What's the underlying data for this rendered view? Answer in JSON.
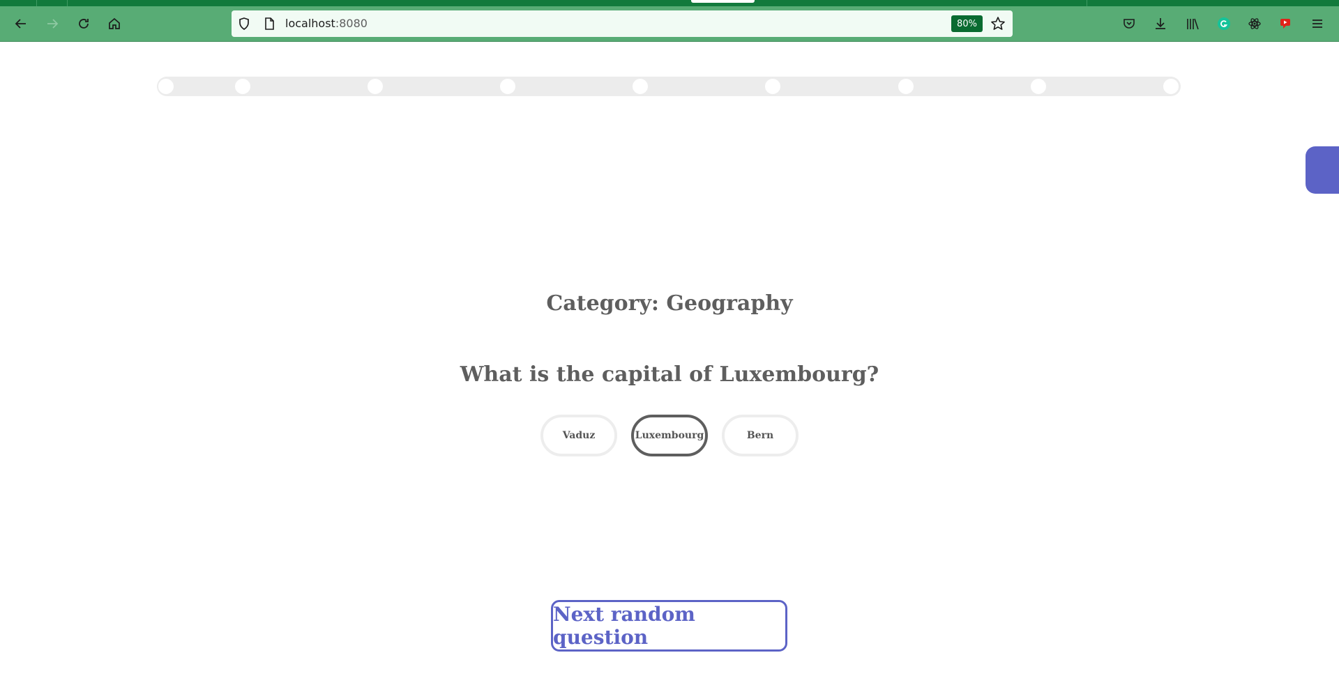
{
  "browser": {
    "url_host": "localhost",
    "url_port": ":8080",
    "zoom": "80%",
    "colors": {
      "toolbar": "#58ac75",
      "tabstrip": "#127a3c",
      "zoom_badge": "#0a6b31"
    },
    "icons": [
      "back-icon",
      "forward-icon",
      "reload-icon",
      "home-icon",
      "shield-icon",
      "page-icon",
      "star-icon",
      "pocket-icon",
      "download-icon",
      "library-icon",
      "grammarly-icon",
      "react-devtools-icon",
      "video-extension-icon",
      "menu-icon"
    ]
  },
  "quiz": {
    "progress_steps": 9,
    "category": "Category: Geography",
    "question": "What is the capital of Luxembourg?",
    "answers": [
      {
        "label": "Vaduz",
        "selected": false
      },
      {
        "label": "Luxembourg",
        "selected": true
      },
      {
        "label": "Bern",
        "selected": false
      }
    ],
    "next_button": "Next random question",
    "colors": {
      "accent": "#5c63c6",
      "text": "#5e5e5e",
      "track": "#ececec"
    }
  }
}
